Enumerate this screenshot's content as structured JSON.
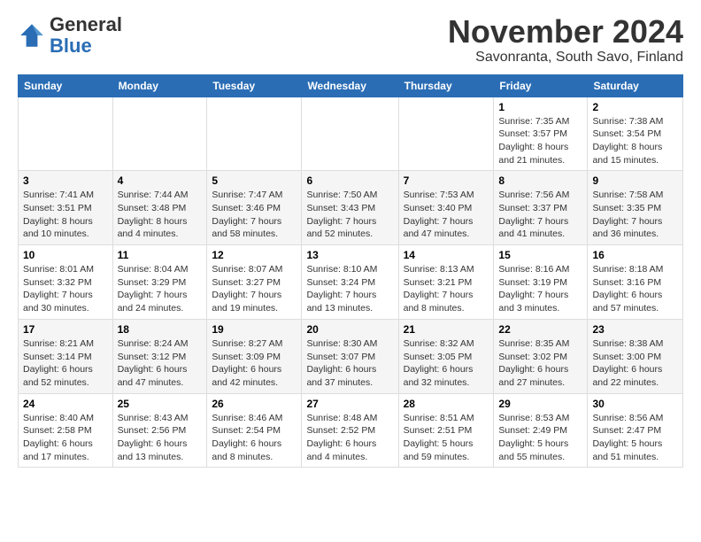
{
  "header": {
    "logo_line1": "General",
    "logo_line2": "Blue",
    "month": "November 2024",
    "location": "Savonranta, South Savo, Finland"
  },
  "days_of_week": [
    "Sunday",
    "Monday",
    "Tuesday",
    "Wednesday",
    "Thursday",
    "Friday",
    "Saturday"
  ],
  "weeks": [
    [
      {
        "day": "",
        "info": ""
      },
      {
        "day": "",
        "info": ""
      },
      {
        "day": "",
        "info": ""
      },
      {
        "day": "",
        "info": ""
      },
      {
        "day": "",
        "info": ""
      },
      {
        "day": "1",
        "info": "Sunrise: 7:35 AM\nSunset: 3:57 PM\nDaylight: 8 hours\nand 21 minutes."
      },
      {
        "day": "2",
        "info": "Sunrise: 7:38 AM\nSunset: 3:54 PM\nDaylight: 8 hours\nand 15 minutes."
      }
    ],
    [
      {
        "day": "3",
        "info": "Sunrise: 7:41 AM\nSunset: 3:51 PM\nDaylight: 8 hours\nand 10 minutes."
      },
      {
        "day": "4",
        "info": "Sunrise: 7:44 AM\nSunset: 3:48 PM\nDaylight: 8 hours\nand 4 minutes."
      },
      {
        "day": "5",
        "info": "Sunrise: 7:47 AM\nSunset: 3:46 PM\nDaylight: 7 hours\nand 58 minutes."
      },
      {
        "day": "6",
        "info": "Sunrise: 7:50 AM\nSunset: 3:43 PM\nDaylight: 7 hours\nand 52 minutes."
      },
      {
        "day": "7",
        "info": "Sunrise: 7:53 AM\nSunset: 3:40 PM\nDaylight: 7 hours\nand 47 minutes."
      },
      {
        "day": "8",
        "info": "Sunrise: 7:56 AM\nSunset: 3:37 PM\nDaylight: 7 hours\nand 41 minutes."
      },
      {
        "day": "9",
        "info": "Sunrise: 7:58 AM\nSunset: 3:35 PM\nDaylight: 7 hours\nand 36 minutes."
      }
    ],
    [
      {
        "day": "10",
        "info": "Sunrise: 8:01 AM\nSunset: 3:32 PM\nDaylight: 7 hours\nand 30 minutes."
      },
      {
        "day": "11",
        "info": "Sunrise: 8:04 AM\nSunset: 3:29 PM\nDaylight: 7 hours\nand 24 minutes."
      },
      {
        "day": "12",
        "info": "Sunrise: 8:07 AM\nSunset: 3:27 PM\nDaylight: 7 hours\nand 19 minutes."
      },
      {
        "day": "13",
        "info": "Sunrise: 8:10 AM\nSunset: 3:24 PM\nDaylight: 7 hours\nand 13 minutes."
      },
      {
        "day": "14",
        "info": "Sunrise: 8:13 AM\nSunset: 3:21 PM\nDaylight: 7 hours\nand 8 minutes."
      },
      {
        "day": "15",
        "info": "Sunrise: 8:16 AM\nSunset: 3:19 PM\nDaylight: 7 hours\nand 3 minutes."
      },
      {
        "day": "16",
        "info": "Sunrise: 8:18 AM\nSunset: 3:16 PM\nDaylight: 6 hours\nand 57 minutes."
      }
    ],
    [
      {
        "day": "17",
        "info": "Sunrise: 8:21 AM\nSunset: 3:14 PM\nDaylight: 6 hours\nand 52 minutes."
      },
      {
        "day": "18",
        "info": "Sunrise: 8:24 AM\nSunset: 3:12 PM\nDaylight: 6 hours\nand 47 minutes."
      },
      {
        "day": "19",
        "info": "Sunrise: 8:27 AM\nSunset: 3:09 PM\nDaylight: 6 hours\nand 42 minutes."
      },
      {
        "day": "20",
        "info": "Sunrise: 8:30 AM\nSunset: 3:07 PM\nDaylight: 6 hours\nand 37 minutes."
      },
      {
        "day": "21",
        "info": "Sunrise: 8:32 AM\nSunset: 3:05 PM\nDaylight: 6 hours\nand 32 minutes."
      },
      {
        "day": "22",
        "info": "Sunrise: 8:35 AM\nSunset: 3:02 PM\nDaylight: 6 hours\nand 27 minutes."
      },
      {
        "day": "23",
        "info": "Sunrise: 8:38 AM\nSunset: 3:00 PM\nDaylight: 6 hours\nand 22 minutes."
      }
    ],
    [
      {
        "day": "24",
        "info": "Sunrise: 8:40 AM\nSunset: 2:58 PM\nDaylight: 6 hours\nand 17 minutes."
      },
      {
        "day": "25",
        "info": "Sunrise: 8:43 AM\nSunset: 2:56 PM\nDaylight: 6 hours\nand 13 minutes."
      },
      {
        "day": "26",
        "info": "Sunrise: 8:46 AM\nSunset: 2:54 PM\nDaylight: 6 hours\nand 8 minutes."
      },
      {
        "day": "27",
        "info": "Sunrise: 8:48 AM\nSunset: 2:52 PM\nDaylight: 6 hours\nand 4 minutes."
      },
      {
        "day": "28",
        "info": "Sunrise: 8:51 AM\nSunset: 2:51 PM\nDaylight: 5 hours\nand 59 minutes."
      },
      {
        "day": "29",
        "info": "Sunrise: 8:53 AM\nSunset: 2:49 PM\nDaylight: 5 hours\nand 55 minutes."
      },
      {
        "day": "30",
        "info": "Sunrise: 8:56 AM\nSunset: 2:47 PM\nDaylight: 5 hours\nand 51 minutes."
      }
    ]
  ]
}
